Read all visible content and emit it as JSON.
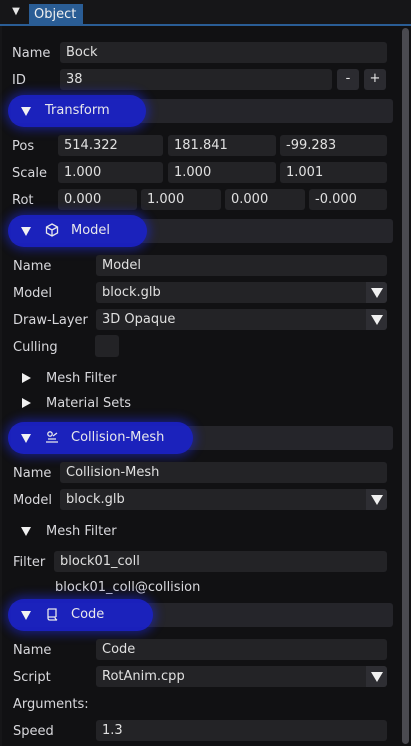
{
  "tab": {
    "title": "Object"
  },
  "object": {
    "name_label": "Name",
    "name_value": "Bock",
    "id_label": "ID",
    "id_value": "38",
    "minus": "-",
    "plus": "+"
  },
  "transform": {
    "header": "Transform",
    "pos_label": "Pos",
    "pos": [
      "514.322",
      "181.841",
      "-99.283"
    ],
    "scale_label": "Scale",
    "scale": [
      "1.000",
      "1.000",
      "1.001"
    ],
    "rot_label": "Rot",
    "rot": [
      "0.000",
      "1.000",
      "0.000",
      "-0.000"
    ]
  },
  "model": {
    "header": "Model",
    "name_label": "Name",
    "name_value": "Model",
    "model_label": "Model",
    "model_value": "block.glb",
    "layer_label": "Draw-Layer",
    "layer_value": "3D Opaque",
    "culling_label": "Culling",
    "mesh_filter": "Mesh Filter",
    "material_sets": "Material Sets"
  },
  "collision": {
    "header": "Collision-Mesh",
    "name_label": "Name",
    "name_value": "Collision-Mesh",
    "model_label": "Model",
    "model_value": "block.glb",
    "mesh_filter": "Mesh Filter",
    "filter_label": "Filter",
    "filter_value": "block01_coll",
    "match": "block01_coll@collision"
  },
  "code": {
    "header": "Code",
    "name_label": "Name",
    "name_value": "Code",
    "script_label": "Script",
    "script_value": "RotAnim.cpp",
    "args_label": "Arguments:",
    "speed_label": "Speed",
    "speed_value": "1.3"
  },
  "icons": {
    "model": "cube-icon",
    "collision": "collision-icon",
    "code": "script-icon"
  },
  "colors": {
    "tab_accent": "#2a5d95",
    "header_glow": "#1b22c8",
    "field_bg": "#232326",
    "header_bg": "#25252a"
  }
}
